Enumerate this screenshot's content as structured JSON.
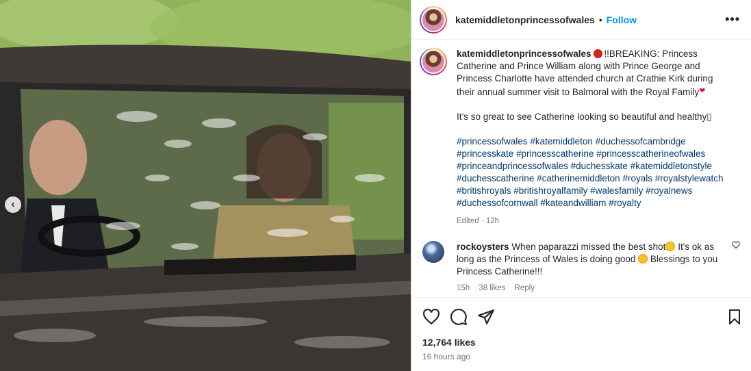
{
  "post": {
    "username": "katemiddletonprincessofwales",
    "follow_label": "Follow",
    "separator": "•",
    "more_label": "•••",
    "caption_lead": "!!BREAKING: Princess Catherine and Prince William along with Prince George and Princess Charlotte have attended church at Crathie Kirk during their annual summer visit to Balmoral with the Royal Family",
    "caption_second": "It’s so great to see Catherine looking so beautiful and healthy▯",
    "hashtags": [
      "#princessofwales",
      "#katemiddleton",
      "#duchessofcambridge",
      "#princesskate",
      "#princesscatherine",
      "#princesscatherineofwales",
      "#princeandprincessofwales",
      "#duchesskate",
      "#katemiddletonstyle",
      "#duchesscatherine",
      "#catherinemiddleton",
      "#royals",
      "#royalstylewatch",
      "#britishroyals",
      "#britishroyalfamily",
      "#walesfamily",
      "#royalnews",
      "#duchessofcornwall",
      "#kateandwilliam",
      "#royalty"
    ],
    "caption_meta": "Edited · 12h",
    "likes": "12,764 likes",
    "time_ago": "16 hours ago"
  },
  "comment": {
    "username": "rockoysters",
    "text_a": "When paparazzi missed the best shot",
    "text_b": " It's ok as long as the Princess of Wales is doing good ",
    "text_c": " Blessings to you Princess Catherine!!!",
    "age": "15h",
    "likes": "38 likes",
    "reply": "Reply"
  },
  "icons": {
    "prev": "chevron-left-icon",
    "like": "heart-icon",
    "comment": "comment-icon",
    "share": "share-icon",
    "save": "bookmark-icon"
  },
  "colors": {
    "link": "#00376b",
    "follow": "#0095f6",
    "muted": "#737373"
  }
}
